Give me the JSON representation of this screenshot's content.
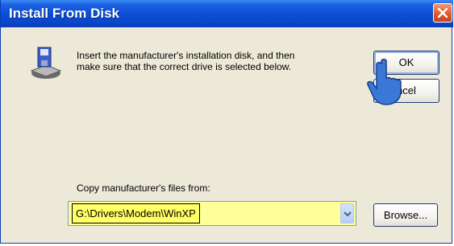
{
  "window": {
    "title": "Install From Disk"
  },
  "message": {
    "line1": "Insert the manufacturer's installation disk, and then",
    "line2": "make sure that the correct drive is selected below."
  },
  "buttons": {
    "ok": "OK",
    "cancel_visible": "ncel",
    "browse": "Browse..."
  },
  "copy_from": {
    "label": "Copy manufacturer's files from:",
    "value": "G:\\Drivers\\Modem\\WinXP"
  },
  "icons": {
    "title_close": "close-icon",
    "disk": "floppy-disk-drive-icon",
    "cursor": "hand-pointer-icon",
    "dropdown": "chevron-down-icon"
  },
  "colors": {
    "titlebar": "#0b4fd6",
    "dialog_bg": "#ece9d8",
    "combo_highlight": "#ffff66"
  }
}
